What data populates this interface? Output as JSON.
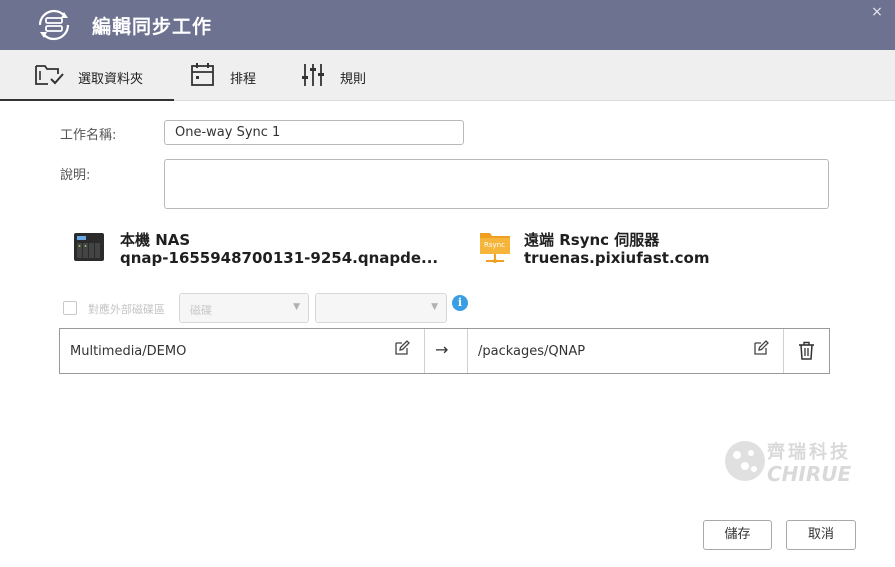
{
  "window": {
    "title": "編輯同步工作",
    "close_label": "×"
  },
  "tabs": [
    {
      "label": "選取資料夾",
      "icon": "folder-check-icon",
      "active": true
    },
    {
      "label": "排程",
      "icon": "calendar-icon",
      "active": false
    },
    {
      "label": "規則",
      "icon": "sliders-icon",
      "active": false
    }
  ],
  "form": {
    "job_name_label": "工作名稱:",
    "job_name_value": "One-way Sync 1",
    "description_label": "說明:",
    "description_value": ""
  },
  "local": {
    "title": "本機 NAS",
    "address": "qnap-1655948700131-9254.qnapde...",
    "icon": "nas-device-icon"
  },
  "remote": {
    "title": "遠端 Rsync 伺服器",
    "address": "truenas.pixiufast.com",
    "icon": "rsync-server-icon",
    "icon_badge": "Rsync"
  },
  "external": {
    "checkbox_label": "對應外部磁碟區",
    "select1_value": "磁碟",
    "select2_value": ""
  },
  "pair": {
    "local_path": "Multimedia/DEMO",
    "arrow": "→",
    "remote_path": "/packages/QNAP"
  },
  "watermark": {
    "cn": "齊瑞科技",
    "en": "CHIRUE"
  },
  "buttons": {
    "save": "儲存",
    "cancel": "取消"
  },
  "colors": {
    "titlebar": "#6e7291",
    "tabbar": "#efeff0",
    "info": "#3a9ee4",
    "rsync_orange": "#f0a020"
  }
}
